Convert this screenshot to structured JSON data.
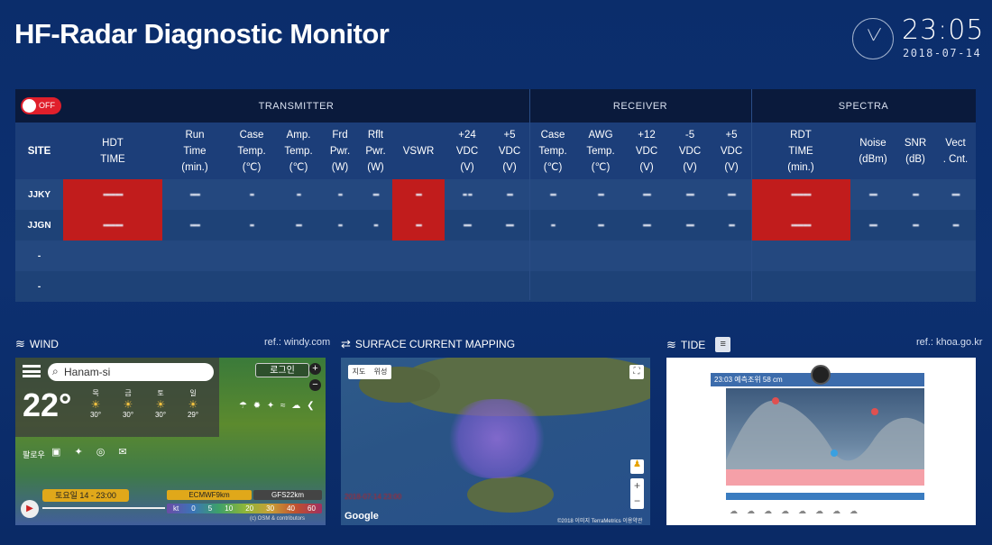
{
  "header": {
    "title": "HF-Radar Diagnostic Monitor",
    "time": "23:05",
    "date": "2018-07-14"
  },
  "toggle": {
    "label": "OFF"
  },
  "groups": {
    "transmitter": "TRANSMITTER",
    "receiver": "RECEIVER",
    "spectra": "SPECTRA"
  },
  "columns": {
    "site": "SITE",
    "hdt1": "HDT",
    "hdt2": "TIME",
    "run1": "Run",
    "run2": "Time",
    "run3": "(min.)",
    "ct1": "Case",
    "ct2": "Temp.",
    "ct3": "(℃)",
    "at1": "Amp.",
    "at2": "Temp.",
    "at3": "(℃)",
    "fp1": "Frd",
    "fp2": "Pwr.",
    "fp3": "(W)",
    "rp1": "Rflt",
    "rp2": "Pwr.",
    "rp3": "(W)",
    "vswr": "VSWR",
    "v24a": "+24",
    "v24b": "VDC",
    "v24c": "(V)",
    "v5a": "+5",
    "v5b": "VDC",
    "v5c": "(V)",
    "rct1": "Case",
    "rct2": "Temp.",
    "rct3": "(℃)",
    "awg1": "AWG",
    "awg2": "Temp.",
    "awg3": "(℃)",
    "v12a": "+12",
    "v12b": "VDC",
    "v12c": "(V)",
    "vm5a": "-5",
    "vm5b": "VDC",
    "vm5c": "(V)",
    "rv5a": "+5",
    "rv5b": "VDC",
    "rv5c": "(V)",
    "rdt1": "RDT",
    "rdt2": "TIME",
    "rdt3": "(min.)",
    "noise1": "Noise",
    "noise2": "(dBm)",
    "snr1": "SNR",
    "snr2": "(dB)",
    "vc1": "Vect",
    "vc2": ". Cnt."
  },
  "rows": [
    {
      "site": "JJKY",
      "hdt": "▪▪▪▪▪▪▪▪▪▪",
      "run": "▪▪▪▪▪",
      "ct": "▪▪",
      "at": "▪▪",
      "fp": "▪▪",
      "rp": "▪▪▪",
      "vswr": "▪▪▪",
      "v24": "▪▪ ▪▪",
      "v5": "▪▪▪",
      "rct": "▪▪▪",
      "awg": "▪▪▪",
      "v12": "▪▪▪▪",
      "vm5": "▪▪▪▪",
      "rv5": "▪▪▪▪",
      "rdt": "▪▪▪▪▪▪▪▪▪▪",
      "noise": "▪▪▪▪",
      "snr": "▪▪▪",
      "vc": "▪▪▪▪"
    },
    {
      "site": "JJGN",
      "hdt": "▪▪▪▪▪▪▪▪▪▪",
      "run": "▪▪▪▪▪",
      "ct": "▪▪",
      "at": "▪▪▪",
      "fp": "▪▪",
      "rp": "▪▪",
      "vswr": "▪▪▪",
      "v24": "▪▪▪▪",
      "v5": "▪▪▪▪",
      "rct": "▪▪",
      "awg": "▪▪▪",
      "v12": "▪▪▪▪",
      "vm5": "▪▪▪▪",
      "rv5": "▪▪▪",
      "rdt": "▪▪▪▪▪▪▪▪▪▪",
      "noise": "▪▪▪▪",
      "snr": "▪▪▪",
      "vc": "▪▪▪"
    },
    {
      "site": "-"
    },
    {
      "site": "-"
    }
  ],
  "panels": {
    "wind": {
      "title": "WIND",
      "ref": "ref.: windy.com",
      "search": "Hanam-si",
      "temp": "22°",
      "login": "로그인",
      "time": "토요일 14 - 23:00",
      "model1": "ECMWF9km",
      "model2": "GFS22km",
      "scale": [
        "kt",
        "0",
        "5",
        "10",
        "20",
        "30",
        "40",
        "60"
      ],
      "follow": "팔로우",
      "forecast": [
        "30°",
        "30°",
        "30°",
        "29°"
      ],
      "days": [
        "목",
        "금",
        "토",
        "일"
      ],
      "copyright": "(c) OSM & contributors"
    },
    "current": {
      "title": "SURFACE CURRENT MAPPING",
      "btn1": "지도",
      "btn2": "위성",
      "stamp": "2018-07-14 23:00",
      "google": "Google",
      "copyright": "©2018 이미지 TerraMetrics 이용약관"
    },
    "tide": {
      "title": "TIDE",
      "ref": "ref.: khoa.go.kr",
      "level": "23:03 예측조위 58 cm"
    }
  },
  "colors": {
    "red": "#c11c1c",
    "header": "#0a1a3c",
    "subheader": "#1c3e79",
    "rowA": "#24487f",
    "rowB": "#1e4277"
  }
}
